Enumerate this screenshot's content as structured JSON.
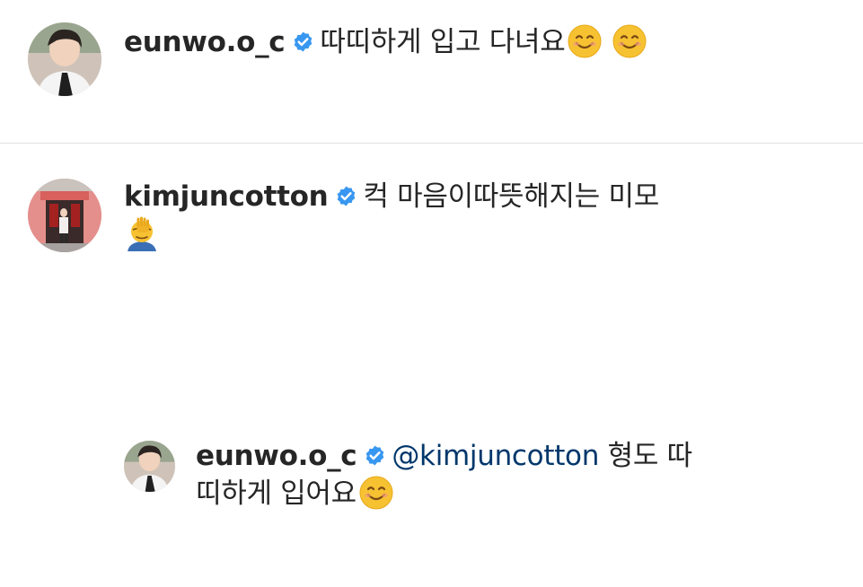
{
  "comments": [
    {
      "username": "eunwo.o_c",
      "verified": true,
      "text": "따띠하게 입고 다녀요",
      "emojis": [
        "smiling-face-icon",
        "smiling-face-icon"
      ]
    },
    {
      "username": "kimjuncotton",
      "verified": true,
      "text": "컥 마음이따뜻해지는 미모",
      "emojis": [
        "face-palm-icon"
      ]
    }
  ],
  "reply": {
    "username": "eunwo.o_c",
    "verified": true,
    "mention": "@kimjuncotton",
    "text_line1": " 형도 따",
    "text_line2": "띠하게 입어요",
    "emojis": [
      "smiling-face-icon"
    ]
  },
  "colors": {
    "text": "#262626",
    "mention": "#00376b",
    "verified_badge": "#3897f0",
    "divider": "#e2e2e2",
    "background": "#ffffff"
  }
}
